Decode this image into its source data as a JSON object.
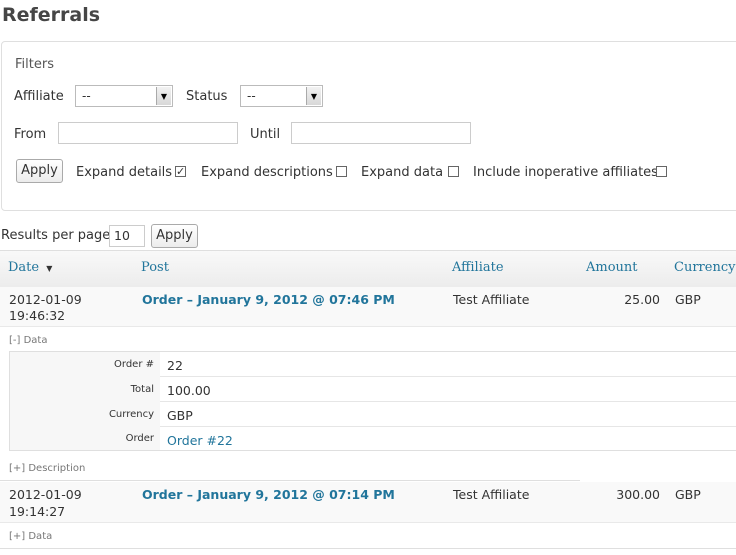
{
  "page": {
    "title": "Referrals"
  },
  "filters": {
    "legend": "Filters",
    "affiliate_label": "Affiliate",
    "affiliate_value": "--",
    "status_label": "Status",
    "status_value": "--",
    "from_label": "From",
    "until_label": "Until",
    "apply_label": "Apply",
    "expand_details_label": "Expand details",
    "expand_details_checked": true,
    "expand_descriptions_label": "Expand descriptions",
    "expand_data_label": "Expand data",
    "include_inoperative_label": "Include inoperative affiliates",
    "checkmark": "✓"
  },
  "pagination": {
    "results_per_page_label": "Results per page",
    "results_per_page_value": "10",
    "apply_label": "Apply"
  },
  "table": {
    "columns": {
      "date": "Date",
      "post": "Post",
      "affiliate": "Affiliate",
      "amount": "Amount",
      "currency": "Currency"
    },
    "sort_indicator": "▼",
    "rows": [
      {
        "date": "2012-01-09",
        "time": "19:46:32",
        "post": "Order – January 9, 2012 @ 07:46 PM",
        "affiliate": "Test Affiliate",
        "amount": "25.00",
        "currency": "GBP",
        "data_toggle": "[-] Data",
        "description_toggle": "[+] Description",
        "data": {
          "order_num_key": "Order #",
          "order_num_value": "22",
          "total_key": "Total",
          "total_value": "100.00",
          "currency_key": "Currency",
          "currency_value": "GBP",
          "order_key": "Order",
          "order_value": "Order #22"
        }
      },
      {
        "date": "2012-01-09",
        "time": "19:14:27",
        "post": "Order – January 9, 2012 @ 07:14 PM",
        "affiliate": "Test Affiliate",
        "amount": "300.00",
        "currency": "GBP",
        "data_toggle": "[+] Data"
      }
    ]
  },
  "colors": {
    "link": "#21759b",
    "border": "#dfdfdf",
    "row_bg": "#f9f9f9"
  }
}
